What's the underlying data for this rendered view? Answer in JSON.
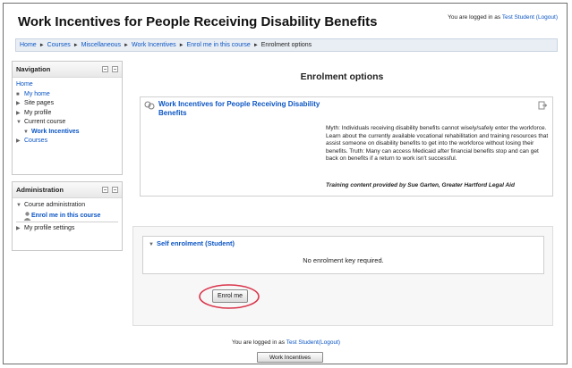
{
  "header": {
    "title": "Work Incentives for People Receiving Disability Benefits",
    "login_prefix": "You are logged in as",
    "user": "Test Student",
    "logout": "(Logout)"
  },
  "breadcrumb": [
    "Home",
    "Courses",
    "Miscellaneous",
    "Work Incentives",
    "Enrol me in this course",
    "Enrolment options"
  ],
  "navigation": {
    "title": "Navigation",
    "home": "Home",
    "my_home": "My home",
    "site_pages": "Site pages",
    "my_profile": "My profile",
    "current_course": "Current course",
    "work_incentives": "Work Incentives",
    "courses": "Courses"
  },
  "administration": {
    "title": "Administration",
    "course_admin": "Course administration",
    "enrol_me": "Enrol me in this course",
    "profile_settings": "My profile settings"
  },
  "main": {
    "heading": "Enrolment options",
    "course_title": "Work Incentives for People Receiving Disability Benefits",
    "summary": "Myth: Individuals receiving disability benefits cannot wisely/safely enter the workforce. Learn about the currently available vocational rehabilitation and training resources that assist someone on disability benefits to get into the workforce without losing their benefits. Truth: Many can access Medicaid after financial benefits stop and can get back on benefits if a return to work isn't successful.",
    "credit": "Training content provided by Sue Garten, Greater Hartford Legal Aid"
  },
  "enrolment": {
    "legend": "Self enrolment (Student)",
    "no_key": "No enrolment key required.",
    "button": "Enrol me"
  },
  "footer": {
    "login_prefix": "You are logged in as",
    "user": "Test Student",
    "logout": "(Logout)",
    "course_button": "Work Incentives"
  },
  "colors": {
    "link": "#0b55c4",
    "highlight": "#d9344a",
    "navbar_bg": "#e9eef4"
  }
}
